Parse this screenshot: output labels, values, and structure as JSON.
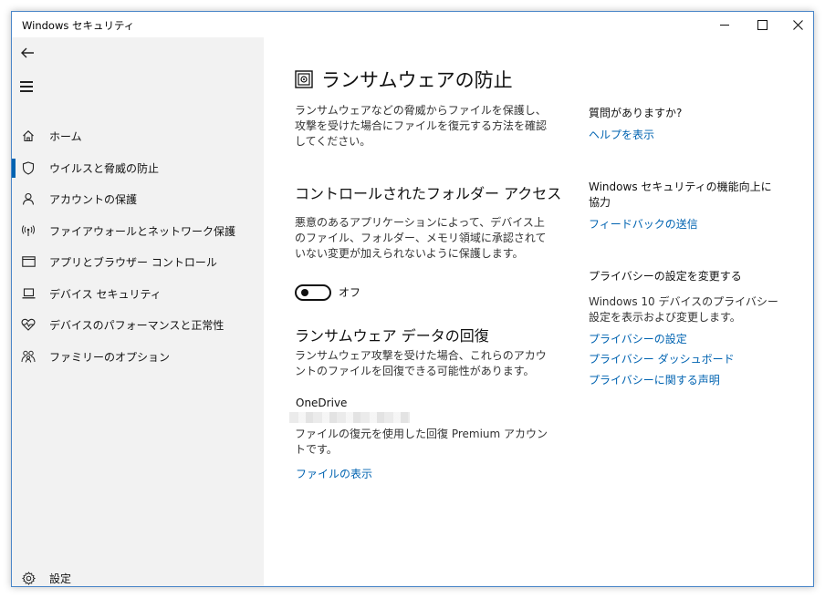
{
  "window": {
    "title": "Windows セキュリティ"
  },
  "sidebar": {
    "items": [
      {
        "label": "ホーム",
        "icon": "home-icon"
      },
      {
        "label": "ウイルスと脅威の防止",
        "icon": "shield-icon",
        "selected": true
      },
      {
        "label": "アカウントの保護",
        "icon": "person-icon"
      },
      {
        "label": "ファイアウォールとネットワーク保護",
        "icon": "antenna-icon"
      },
      {
        "label": "アプリとブラウザー コントロール",
        "icon": "browser-window-icon"
      },
      {
        "label": "デバイス セキュリティ",
        "icon": "laptop-icon"
      },
      {
        "label": "デバイスのパフォーマンスと正常性",
        "icon": "heart-pulse-icon"
      },
      {
        "label": "ファミリーのオプション",
        "icon": "family-icon"
      }
    ],
    "settings_label": "設定"
  },
  "main": {
    "title": "ランサムウェアの防止",
    "intro": "ランサムウェアなどの脅威からファイルを保護し、攻撃を受けた場合にファイルを復元する方法を確認してください。",
    "cfa": {
      "heading": "コントロールされたフォルダー アクセス",
      "desc": "悪意のあるアプリケーションによって、デバイス上のファイル、フォルダー、メモリ領域に承認されていない変更が加えられないように保護します。",
      "toggle_label": "オフ",
      "toggle_on": false
    },
    "recovery": {
      "heading": "ランサムウェア データの回復",
      "desc": "ランサムウェア攻撃を受けた場合、これらのアカウントのファイルを回復できる可能性があります。",
      "account_name": "OneDrive",
      "account_desc": "ファイルの復元を使用した回復 Premium アカウントです。",
      "link": "ファイルの表示"
    }
  },
  "right": {
    "q_heading": "質問がありますか?",
    "q_link": "ヘルプを表示",
    "improve_heading": "Windows セキュリティの機能向上に協力",
    "improve_link": "フィードバックの送信",
    "privacy_heading": "プライバシーの設定を変更する",
    "privacy_desc": "Windows 10 デバイスのプライバシー設定を表示および変更します。",
    "privacy_links": [
      "プライバシーの設定",
      "プライバシー ダッシュボード",
      "プライバシーに関する声明"
    ]
  },
  "colors": {
    "accent": "#0063b1",
    "sidebar_bg": "#f2f2f2",
    "window_border": "#4a86c8"
  }
}
